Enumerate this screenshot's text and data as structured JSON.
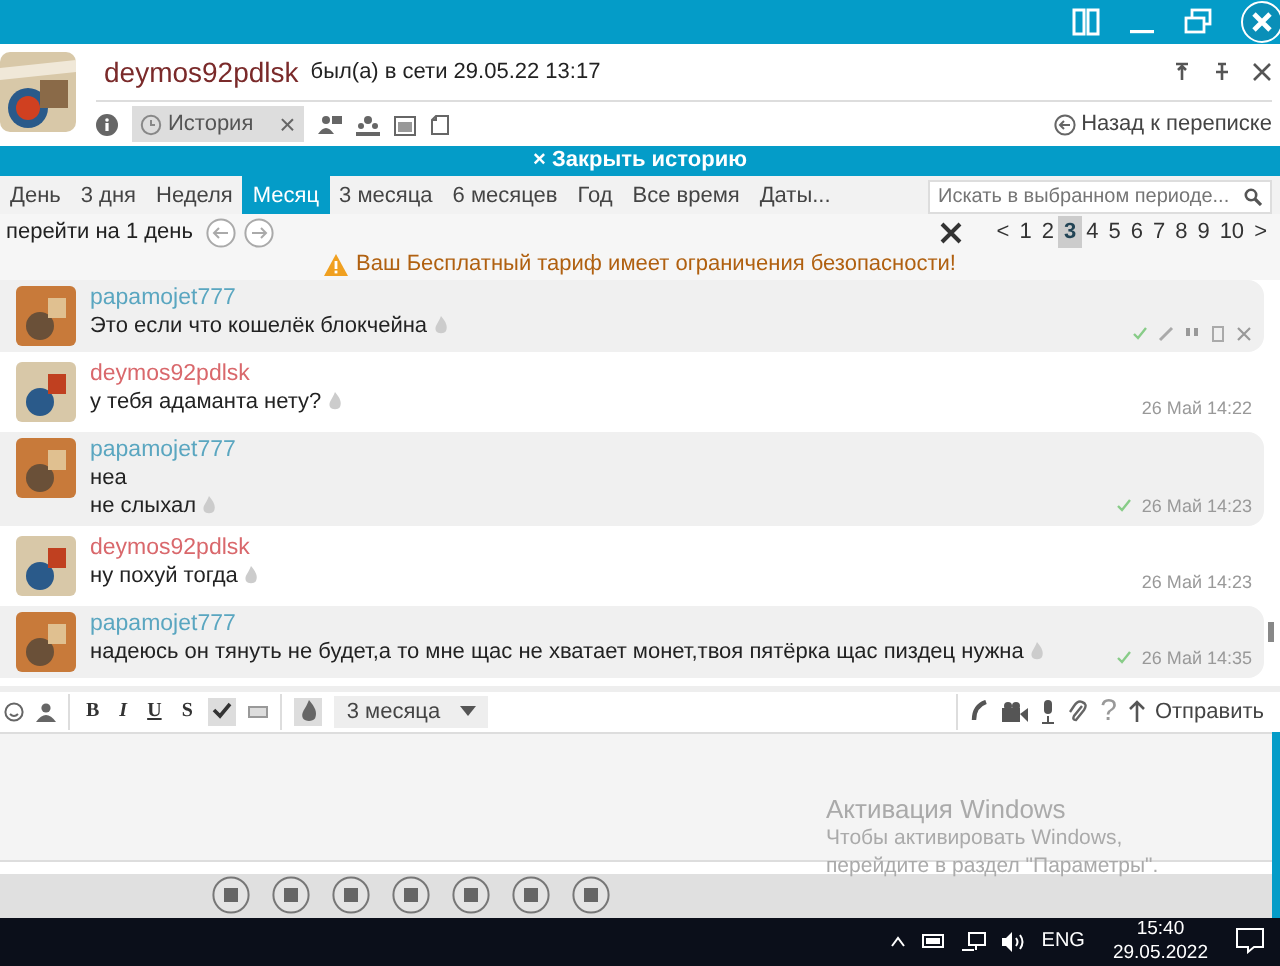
{
  "contact": {
    "name": "deymos92pdlsk",
    "status": "был(а) в сети 29.05.22 13:17"
  },
  "history_tab": {
    "label": "История",
    "close": "×"
  },
  "back_link": "Назад к переписке",
  "close_history": "× Закрыть историю",
  "periods": [
    {
      "label": "День",
      "selected": false
    },
    {
      "label": "3 дня",
      "selected": false
    },
    {
      "label": "Неделя",
      "selected": false
    },
    {
      "label": "Месяц",
      "selected": true
    },
    {
      "label": "3 месяца",
      "selected": false
    },
    {
      "label": "6 месяцев",
      "selected": false
    },
    {
      "label": "Год",
      "selected": false
    },
    {
      "label": "Все время",
      "selected": false
    },
    {
      "label": "Даты...",
      "selected": false
    }
  ],
  "search": {
    "placeholder": "Искать в выбранном периоде..."
  },
  "jump_label": "перейти на 1 день",
  "pagination": {
    "prev": "<",
    "next": ">",
    "pages": [
      {
        "label": "1",
        "selected": false
      },
      {
        "label": "2",
        "selected": false
      },
      {
        "label": "3",
        "selected": true
      },
      {
        "label": "4",
        "selected": false
      },
      {
        "label": "5",
        "selected": false
      },
      {
        "label": "6",
        "selected": false
      },
      {
        "label": "7",
        "selected": false
      },
      {
        "label": "8",
        "selected": false
      },
      {
        "label": "9",
        "selected": false
      },
      {
        "label": "10",
        "selected": false
      }
    ]
  },
  "warning": "Ваш Бесплатный тариф имеет ограничения безопасности!",
  "messages": [
    {
      "author": "papamojet777",
      "color": "#5aa6c0",
      "highlighted": true,
      "lines": [
        "Это если что кошелёк блокчейна"
      ],
      "hovered": true
    },
    {
      "author": "deymos92pdlsk",
      "color": "#d9686c",
      "highlighted": false,
      "lines": [
        "у тебя адаманта нету?"
      ],
      "time": "26 Май 14:22",
      "hovered": false,
      "read": false
    },
    {
      "author": "papamojet777",
      "color": "#5aa6c0",
      "highlighted": true,
      "lines": [
        "неа",
        "не слыхал"
      ],
      "time": "26 Май 14:23",
      "hovered": false,
      "read": true
    },
    {
      "author": "deymos92pdlsk",
      "color": "#d9686c",
      "highlighted": false,
      "lines": [
        "ну похуй тогда"
      ],
      "time": "26 Май 14:23",
      "hovered": false,
      "read": false
    },
    {
      "author": "papamojet777",
      "color": "#5aa6c0",
      "highlighted": true,
      "lines": [
        "надеюсь он тянуть не будет,а то мне щас не хватает монет,твоя пятёрка щас пиздец нужна"
      ],
      "time": "26 Май 14:35",
      "hovered": false,
      "read": true
    }
  ],
  "format_buttons": [
    {
      "label": "B",
      "kind": "bold"
    },
    {
      "label": "I",
      "kind": "italic"
    },
    {
      "label": "U",
      "kind": "underline"
    },
    {
      "label": "S",
      "kind": "strike"
    }
  ],
  "spellcheck": {
    "selected": true
  },
  "burn": {
    "on": true
  },
  "burn_period": "3 месяца",
  "help": "?",
  "send": "Отправить",
  "activation": {
    "title": "Активация Windows",
    "text": "Чтобы активировать Windows, перейдите в раздел \"Параметры\"."
  },
  "taskbar": {
    "language": "ENG",
    "time": "15:40",
    "date": "29.05.2022"
  }
}
